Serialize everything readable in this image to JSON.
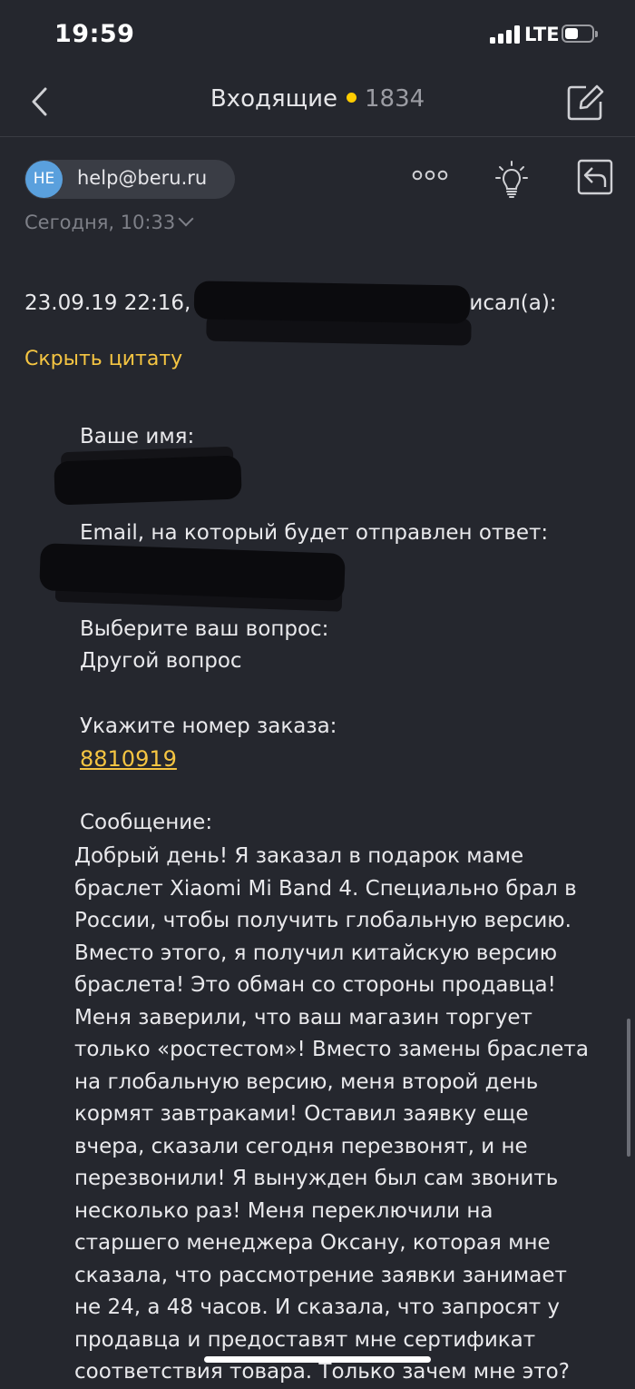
{
  "status_bar": {
    "time": "19:59",
    "network": "LTE"
  },
  "nav": {
    "title": "Входящие",
    "unread_count": "1834"
  },
  "email": {
    "sender_initials": "HE",
    "sender_email": "help@beru.ru",
    "date": "Сегодня, 10:33",
    "quote_date": "23.09.19 22:16,",
    "quote_suffix": "писал(а):",
    "hide_quote": "Скрыть цитату",
    "name_label": "Ваше имя:",
    "email_label": "Email, на который будет отправлен ответ:",
    "question_label": "Выберите ваш вопрос:",
    "question_value": "Другой вопрос",
    "order_label": "Укажите номер заказа:",
    "order_number": "8810919",
    "message_label": "Сообщение:",
    "message_text": "Добрый день! Я заказал в подарок маме\nбраслет Xiaomi Mi Band 4. Специально брал в\nРоссии, чтобы получить глобальную версию.\nВместо этого, я получил китайскую версию\nбраслета! Это обман со стороны продавца!\nМеня заверили, что ваш магазин торгует\nтолько «ростестом»! Вместо замены браслета\nна глобальную версию, меня второй день\nкормят завтраками! Оставил заявку еще\nвчера, сказали сегодня перезвонят, и не\nперезвонили! Я вынужден был сам звонить\nнесколько раз! Меня переключили на\nстаршего менеджера Оксану, которая мне\nсказала, что рассмотрение заявки занимает\nне 24, а 48 часов. И сказала, что запросят у\nпродавца и предоставят мне сертификат\nсоответствия товара. Только зачем мне это?"
  },
  "colors": {
    "background": "#25272e",
    "accent": "#f5c542",
    "avatar": "#5aa0dd"
  },
  "icons": [
    "signal-icon",
    "battery-icon",
    "back-icon",
    "compose-icon",
    "more-icon",
    "bulb-icon",
    "reply-icon",
    "chevron-down-icon"
  ]
}
